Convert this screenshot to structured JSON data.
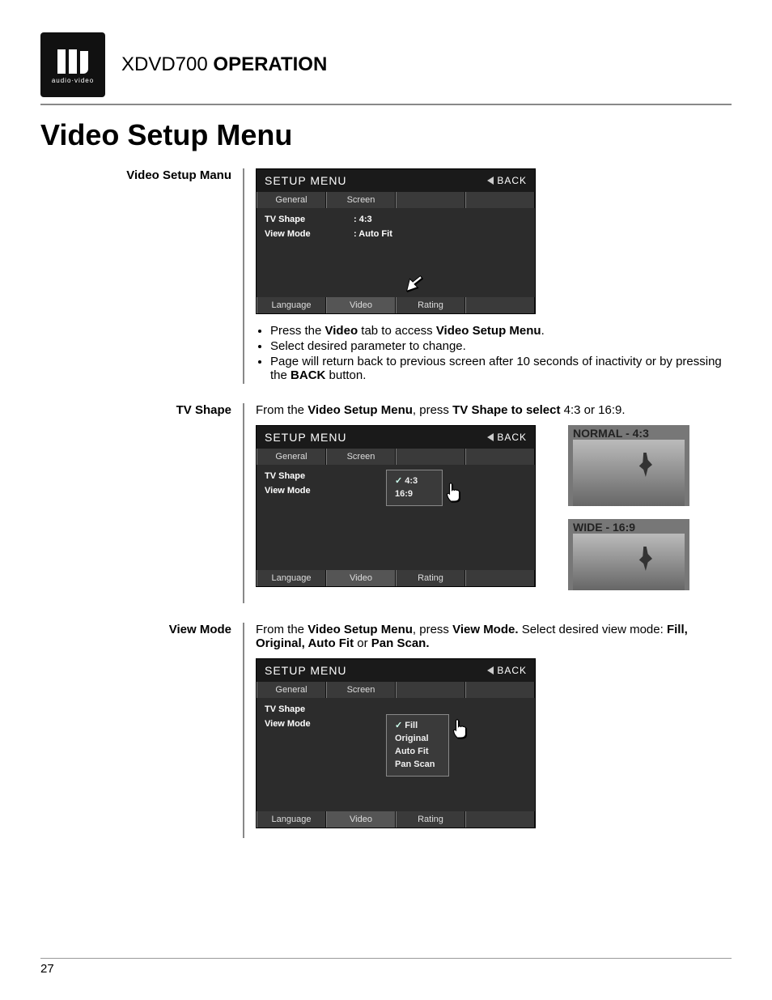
{
  "header": {
    "model": "XDVD700",
    "word": "OPERATION",
    "logo_sub": "audio·video"
  },
  "title": "Video Setup Menu",
  "page_number": "27",
  "labels": {
    "setup_menu": "SETUP MENU",
    "back": "BACK",
    "tab_general": "General",
    "tab_screen": "Screen",
    "btab_language": "Language",
    "btab_video": "Video",
    "btab_rating": "Rating",
    "tv_shape": "TV Shape",
    "view_mode": "View Mode"
  },
  "section1": {
    "heading": "Video Setup Manu",
    "kv_tvshape": ":   4:3",
    "kv_viewmode": ": Auto Fit",
    "b1a": "Press the ",
    "b1b": "Video",
    "b1c": " tab to access ",
    "b1d": "Video Setup Menu",
    "b1e": ".",
    "b2": "Select desired parameter to change.",
    "b3a": "Page will return back to previous screen after 10 seconds of inactivity or by pressing the ",
    "b3b": "BACK",
    "b3c": " button."
  },
  "section2": {
    "heading": "TV Shape",
    "pre": "From the ",
    "b1": "Video Setup Menu",
    "mid": ", press ",
    "b2": "TV Shape to select",
    "post": " 4:3 or 16:9.",
    "opt1": "4:3",
    "opt2": "16:9",
    "thumb1": "NORMAL - 4:3",
    "thumb2": "WIDE - 16:9"
  },
  "section3": {
    "heading": "View Mode",
    "pre": "From the ",
    "b1": "Video Setup Menu",
    "mid": ", press ",
    "b2": "View Mode.",
    "post": " Select desired view mode: ",
    "b3": "Fill, Original, Auto Fit",
    "or": " or ",
    "b4": "Pan Scan.",
    "opt1": "Fill",
    "opt2": "Original",
    "opt3": "Auto Fit",
    "opt4": "Pan Scan"
  }
}
